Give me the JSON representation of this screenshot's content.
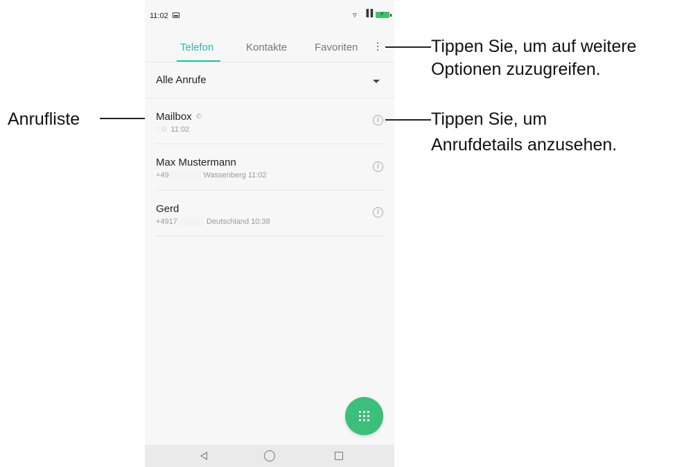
{
  "status_bar": {
    "time": "11:02"
  },
  "tabs": [
    {
      "label": "Telefon",
      "active": true
    },
    {
      "label": "Kontakte",
      "active": false
    },
    {
      "label": "Favoriten",
      "active": false
    }
  ],
  "filter": {
    "label": "Alle Anrufe"
  },
  "calls": [
    {
      "name": "Mailbox",
      "detail": "11:02",
      "number_masked": ":::0"
    },
    {
      "name": "Max Mustermann",
      "detail": "Wassenberg  11:02",
      "number_masked": "+49"
    },
    {
      "name": "Gerd",
      "detail": "Deutschland  10:38",
      "number_masked": "+4917"
    }
  ],
  "annotations": {
    "call_list": "Anrufliste",
    "more_options_line1": "Tippen Sie, um auf weitere",
    "more_options_line2": "Optionen zuzugreifen.",
    "call_details_line1": "Tippen Sie, um",
    "call_details_line2": "Anrufdetails anzusehen."
  },
  "colors": {
    "accent": "#1fbfae",
    "fab": "#3bbf7b",
    "battery": "#3bc46a"
  }
}
